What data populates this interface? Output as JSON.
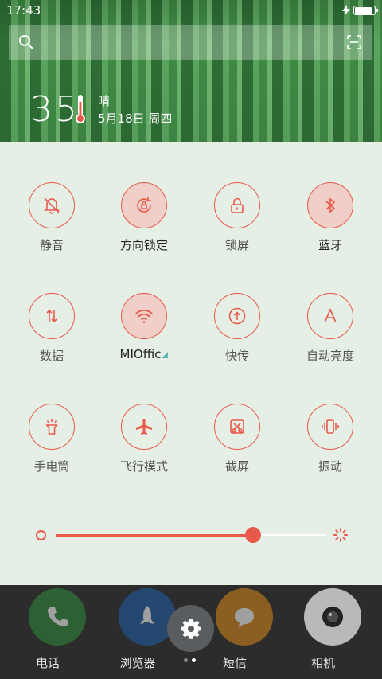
{
  "status_bar": {
    "time": "17:43"
  },
  "weather": {
    "temperature": "35",
    "condition": "晴",
    "date": "5月18日 周四"
  },
  "toggles": [
    {
      "label": "静音",
      "icon": "bell-off-icon",
      "on": false
    },
    {
      "label": "方向锁定",
      "icon": "rotation-lock-icon",
      "on": true
    },
    {
      "label": "锁屏",
      "icon": "lock-icon",
      "on": false
    },
    {
      "label": "蓝牙",
      "icon": "bluetooth-icon",
      "on": true
    },
    {
      "label": "数据",
      "icon": "data-arrows-icon",
      "on": false
    },
    {
      "label": "MIOffic",
      "icon": "wifi-icon",
      "on": true
    },
    {
      "label": "快传",
      "icon": "share-upload-icon",
      "on": false
    },
    {
      "label": "自动亮度",
      "icon": "auto-brightness-icon",
      "on": false
    },
    {
      "label": "手电筒",
      "icon": "flashlight-icon",
      "on": false
    },
    {
      "label": "飞行模式",
      "icon": "airplane-icon",
      "on": false
    },
    {
      "label": "截屏",
      "icon": "screenshot-icon",
      "on": false
    },
    {
      "label": "振动",
      "icon": "vibrate-icon",
      "on": false
    }
  ],
  "brightness": {
    "level": 0.73
  },
  "dock": {
    "apps": [
      {
        "label": "电话",
        "icon": "phone-icon",
        "color": "#2e8b3a"
      },
      {
        "label": "浏览器",
        "icon": "rocket-icon",
        "color": "#1f5fa8"
      },
      {
        "label": "短信",
        "icon": "message-icon",
        "color": "#d9891a"
      },
      {
        "label": "相机",
        "icon": "camera-icon",
        "color": "#dddddd"
      }
    ],
    "page_dots": 2,
    "active_dot": 1
  },
  "colors": {
    "accent": "#e8594a",
    "toggle_on_fill": "#efcfc8",
    "panel_bg": "#e6efe6"
  }
}
